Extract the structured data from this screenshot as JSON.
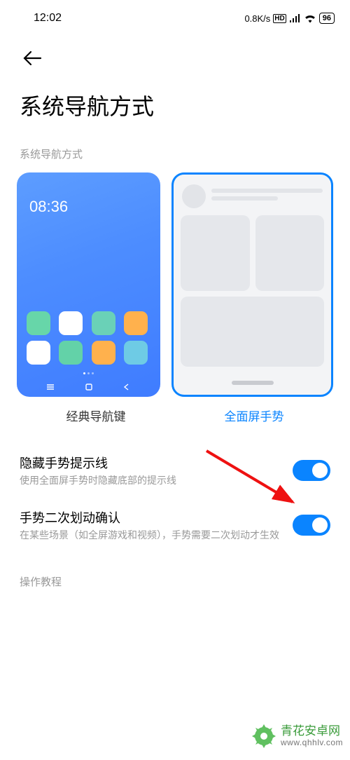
{
  "statusbar": {
    "time": "12:02",
    "speed": "0.8K/s",
    "hd": "HD",
    "battery": "96"
  },
  "page": {
    "title": "系统导航方式",
    "section_label": "系统导航方式"
  },
  "nav_options": {
    "classic": {
      "label": "经典导航键",
      "clock": "08:36"
    },
    "gesture": {
      "label": "全面屏手势"
    }
  },
  "settings": [
    {
      "title": "隐藏手势提示线",
      "desc": "使用全面屏手势时隐藏底部的提示线"
    },
    {
      "title": "手势二次划动确认",
      "desc": "在某些场景（如全屏游戏和视频），手势需要二次划动才生效"
    }
  ],
  "tutorial_label": "操作教程",
  "watermark": {
    "name": "青花安卓网",
    "url": "www.qhhlv.com"
  },
  "icon_colors": [
    "#67d6a9",
    "#ffffff",
    "#6ad1b7",
    "#ffb14d",
    "#ffffff",
    "#63d2a8",
    "#ffb14d",
    "#6ecbe5"
  ],
  "accent": "#0a84ff"
}
